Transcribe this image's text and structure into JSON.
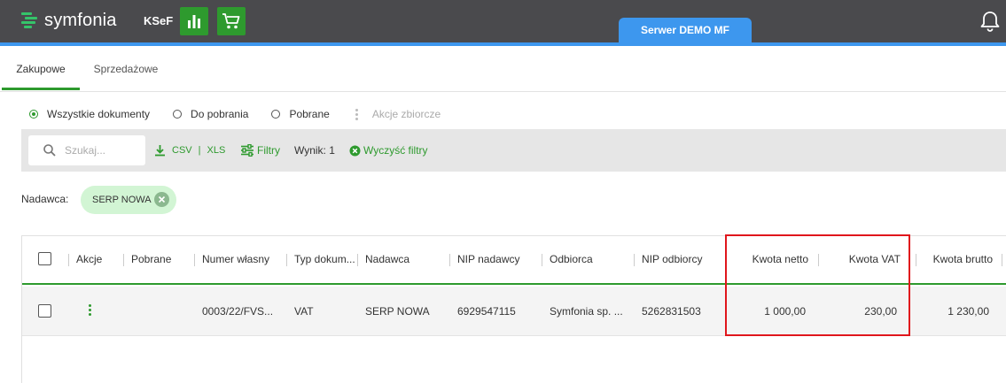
{
  "header": {
    "logo_text": "symfonia",
    "app_name": "KSeF",
    "server_label": "Serwer DEMO MF",
    "colors": {
      "bar": "#4a4a4d",
      "accent": "#3d97ee",
      "green": "#2e9a2e"
    }
  },
  "tabs": [
    {
      "label": "Zakupowe",
      "active": true
    },
    {
      "label": "Sprzedażowe",
      "active": false
    }
  ],
  "filters": {
    "radios": [
      {
        "label": "Wszystkie dokumenty",
        "checked": true
      },
      {
        "label": "Do pobrania",
        "checked": false
      },
      {
        "label": "Pobrane",
        "checked": false
      }
    ],
    "bulk_actions_label": "Akcje zbiorcze"
  },
  "toolbar": {
    "search_placeholder": "Szukaj...",
    "csv_label": "CSV",
    "separator": "|",
    "xls_label": "XLS",
    "filters_label": "Filtry",
    "result_label": "Wynik: 1",
    "clear_filters_label": "Wyczyść filtry"
  },
  "active_filter": {
    "label": "Nadawca:",
    "chip": "SERP NOWA"
  },
  "table": {
    "columns": [
      "Akcje",
      "Pobrane",
      "Numer własny",
      "Typ dokum...",
      "Nadawca",
      "NIP nadawcy",
      "Odbiorca",
      "NIP odbiorcy",
      "Kwota netto",
      "Kwota VAT",
      "Kwota brutto"
    ],
    "rows": [
      {
        "pobrane": "",
        "numer": "0003/22/FVS...",
        "typ": "VAT",
        "nadawca": "SERP NOWA",
        "nip_nadawcy": "6929547115",
        "odbiorca": "Symfonia sp. ...",
        "nip_odbiorcy": "5262831503",
        "netto": "1 000,00",
        "vat": "230,00",
        "brutto": "1 230,00"
      }
    ]
  }
}
